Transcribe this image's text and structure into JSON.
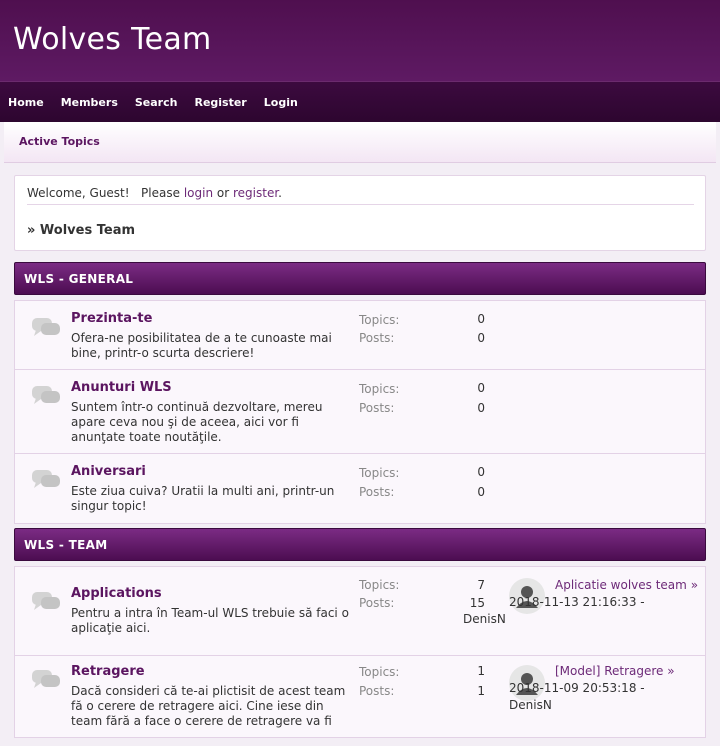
{
  "header": {
    "title": "Wolves Team"
  },
  "nav": {
    "items": [
      "Home",
      "Members",
      "Search",
      "Register",
      "Login"
    ]
  },
  "subbar": {
    "active_topics": "Active Topics"
  },
  "welcome": {
    "greeting": "Welcome, Guest!",
    "please": "Please",
    "login": "login",
    "or": "or",
    "register": "register",
    "end": ".",
    "crumb": "» Wolves Team"
  },
  "categories": [
    {
      "title": "WLS - GENERAL",
      "boards": [
        {
          "name": "Prezinta-te",
          "desc": "Ofera-ne posibilitatea de a te cunoaste mai bine, printr-o scurta descriere!",
          "topics_label": "Topics:",
          "topics": "0",
          "posts_label": "Posts:",
          "posts": "0"
        },
        {
          "name": "Anunturi WLS",
          "desc": "Suntem într-o continuă dezvoltare, mereu apare ceva nou şi de aceea, aici vor fi anunţate toate noutăţile.",
          "topics_label": "Topics:",
          "topics": "0",
          "posts_label": "Posts:",
          "posts": "0"
        },
        {
          "name": "Aniversari",
          "desc": "Este ziua cuiva? Uratii la multi ani, printr-un singur topic!",
          "topics_label": "Topics:",
          "topics": "0",
          "posts_label": "Posts:",
          "posts": "0"
        }
      ]
    },
    {
      "title": "WLS - TEAM",
      "boards": [
        {
          "name": "Applications",
          "desc": "Pentru a intra în Team-ul WLS trebuie să faci o aplicaţie aici.",
          "topics_label": "Topics:",
          "topics": "7",
          "posts_label": "Posts:",
          "posts": "15",
          "last": {
            "title": "Aplicatie wolves team",
            "arrow": "»",
            "date": "2018-11-13 21:16:33 -",
            "author": "DenisN"
          }
        },
        {
          "name": "Retragere",
          "desc": "Dacă consideri că te-ai plictisit de acest team fă o cerere de retragere aici. Cine iese din team fără a face o cerere de retragere va fi",
          "topics_label": "Topics:",
          "topics": "1",
          "posts_label": "Posts:",
          "posts": "1",
          "last": {
            "title": "[Model] Retragere",
            "arrow": "»",
            "date": "2018-11-09 20:53:18 -",
            "author": "DenisN"
          }
        }
      ]
    }
  ],
  "colors": {
    "header": "#4f0f4f",
    "navbar": "#2d062f",
    "accent": "#5b1560",
    "link": "#6d2a78",
    "background": "#f3eef5"
  },
  "icons": {
    "board": "chat-bubbles-icon",
    "avatar": "default-user-avatar-icon"
  }
}
